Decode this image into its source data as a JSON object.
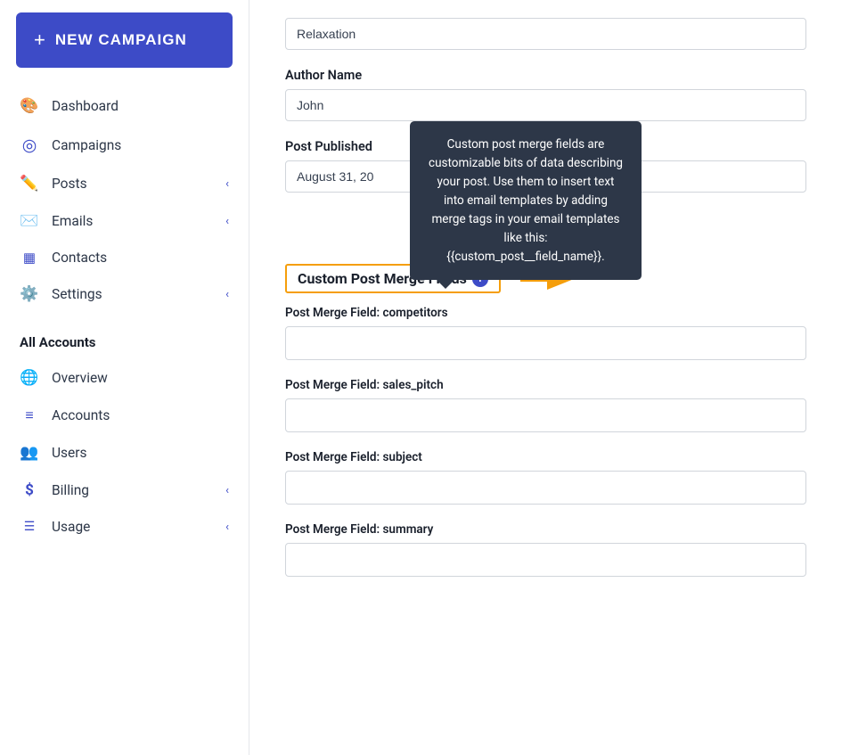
{
  "sidebar": {
    "new_campaign_label": "NEW CAMPAIGN",
    "nav_items": [
      {
        "id": "dashboard",
        "label": "Dashboard",
        "icon": "🎨",
        "has_chevron": false
      },
      {
        "id": "campaigns",
        "label": "Campaigns",
        "icon": "◎",
        "has_chevron": false
      },
      {
        "id": "posts",
        "label": "Posts",
        "icon": "✏️",
        "has_chevron": true
      },
      {
        "id": "emails",
        "label": "Emails",
        "icon": "✉️",
        "has_chevron": true
      },
      {
        "id": "contacts",
        "label": "Contacts",
        "icon": "📋",
        "has_chevron": false
      },
      {
        "id": "settings",
        "label": "Settings",
        "icon": "⚙️",
        "has_chevron": true
      }
    ],
    "all_accounts_header": "All Accounts",
    "account_items": [
      {
        "id": "overview",
        "label": "Overview",
        "icon": "🌐",
        "has_chevron": false
      },
      {
        "id": "accounts",
        "label": "Accounts",
        "icon": "≡",
        "has_chevron": false
      },
      {
        "id": "users",
        "label": "Users",
        "icon": "👥",
        "has_chevron": false
      },
      {
        "id": "billing",
        "label": "Billing",
        "icon": "$",
        "has_chevron": true
      },
      {
        "id": "usage",
        "label": "Usage",
        "icon": "☰",
        "has_chevron": true
      }
    ]
  },
  "main": {
    "relaxation_value": "Relaxation",
    "author_name_label": "Author Name",
    "author_name_value": "John",
    "post_published_label": "Post Published",
    "post_published_value": "August 31, 20",
    "custom_merge_fields_label": "Custom Post Merge Fields",
    "info_icon_label": "i",
    "tooltip_text": "Custom post merge fields are customizable bits of data describing your post. Use them to insert text into email templates by adding merge tags in your email templates like this: {{custom_post__field_name}}.",
    "merge_fields": [
      {
        "id": "competitors",
        "label": "Post Merge Field: competitors",
        "value": ""
      },
      {
        "id": "sales_pitch",
        "label": "Post Merge Field: sales_pitch",
        "value": ""
      },
      {
        "id": "subject",
        "label": "Post Merge Field: subject",
        "value": ""
      },
      {
        "id": "summary",
        "label": "Post Merge Field: summary",
        "value": ""
      }
    ]
  }
}
